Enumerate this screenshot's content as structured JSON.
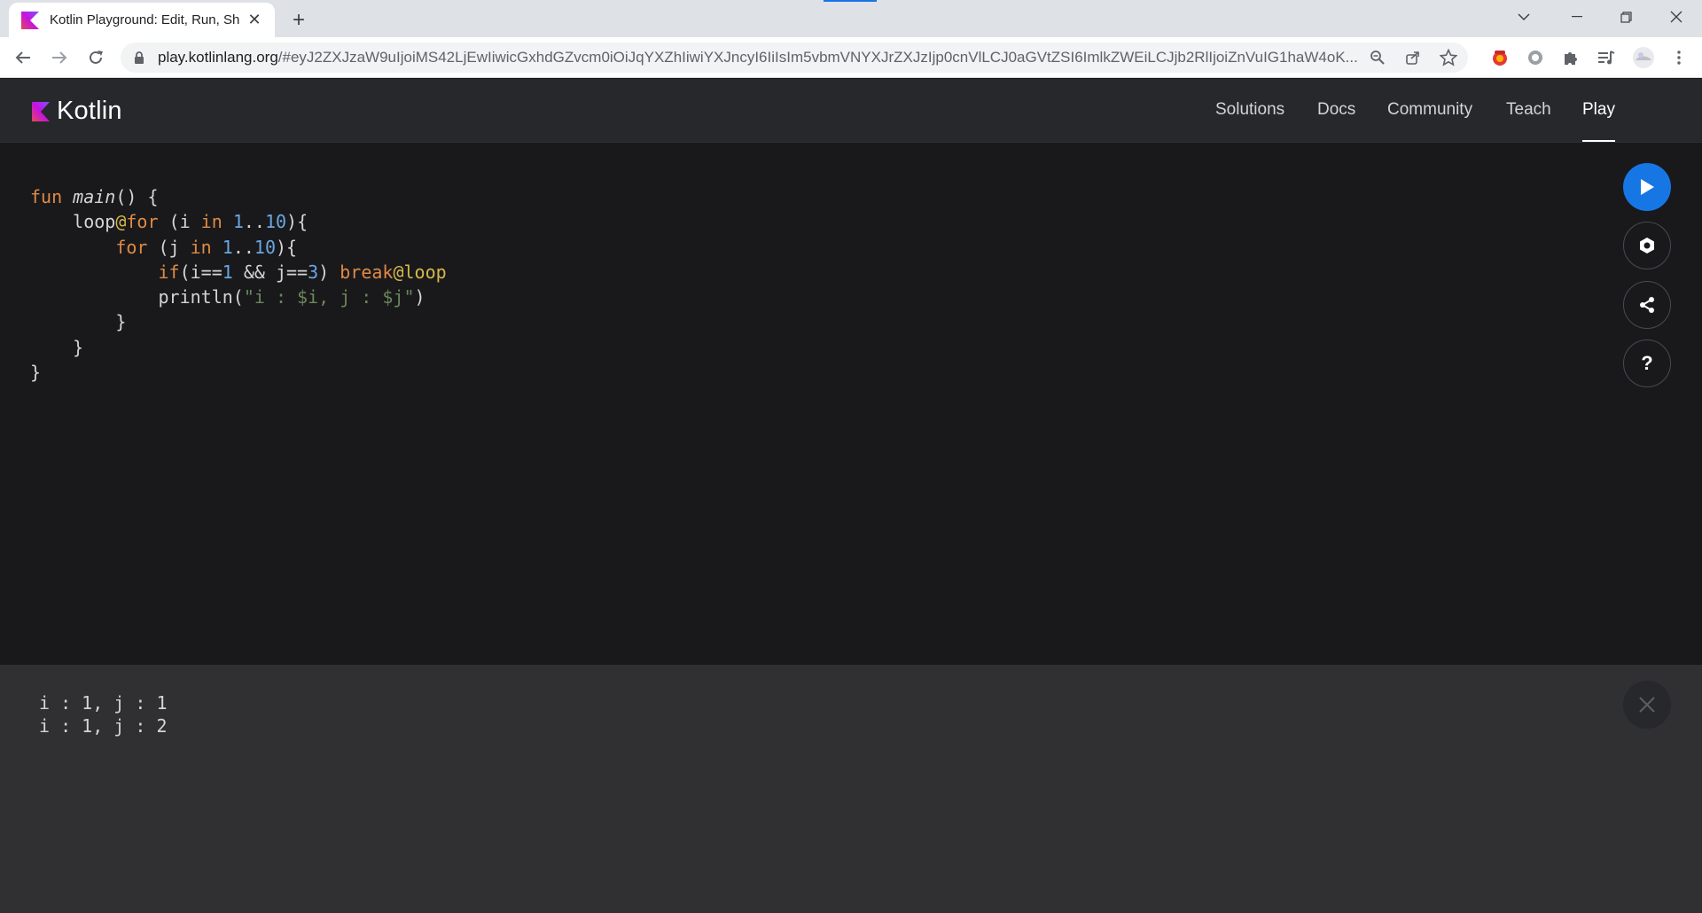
{
  "browser": {
    "tab_title": "Kotlin Playground: Edit, Run, Sh",
    "url_host": "play.kotlinlang.org",
    "url_rest": "/#eyJ2ZXJzaW9uIjoiMS42LjEwIiwicGxhdGZvcm0iOiJqYXZhIiwiYXJncyI6IiIsIm5vbmVNYXJrZXJzIjp0cnVlLCJ0aGVtZSI6ImlkZWEiLCJjb2RlIjoiZnVuIG1haW4oK..."
  },
  "site": {
    "logo_text": "Kotlin",
    "nav": [
      "Solutions",
      "Docs",
      "Community",
      "Teach",
      "Play"
    ],
    "active_nav": "Play"
  },
  "editor": {
    "code_lines": [
      "fun main() {",
      "    loop@for (i in 1..10){",
      "        for (j in 1..10){",
      "            if(i==1 && j==3) break@loop",
      "            println(\"i : $i, j : $j\")",
      "        }",
      "    }",
      "}"
    ]
  },
  "side_buttons": [
    "run",
    "settings",
    "share",
    "help"
  ],
  "side_icons": {
    "run": "play-icon",
    "settings": "gear-icon",
    "share": "share-icon",
    "help": "question-icon"
  },
  "help_label": "?",
  "output": {
    "lines": [
      "i : 1, j : 1",
      "i : 1, j : 2"
    ]
  },
  "colors": {
    "keyword": "#e08a44",
    "number": "#6aa7e0",
    "label": "#d6b84a",
    "string": "#6a8759",
    "run_button": "#1677e4",
    "kotlin_purple": "#7f52ff"
  }
}
